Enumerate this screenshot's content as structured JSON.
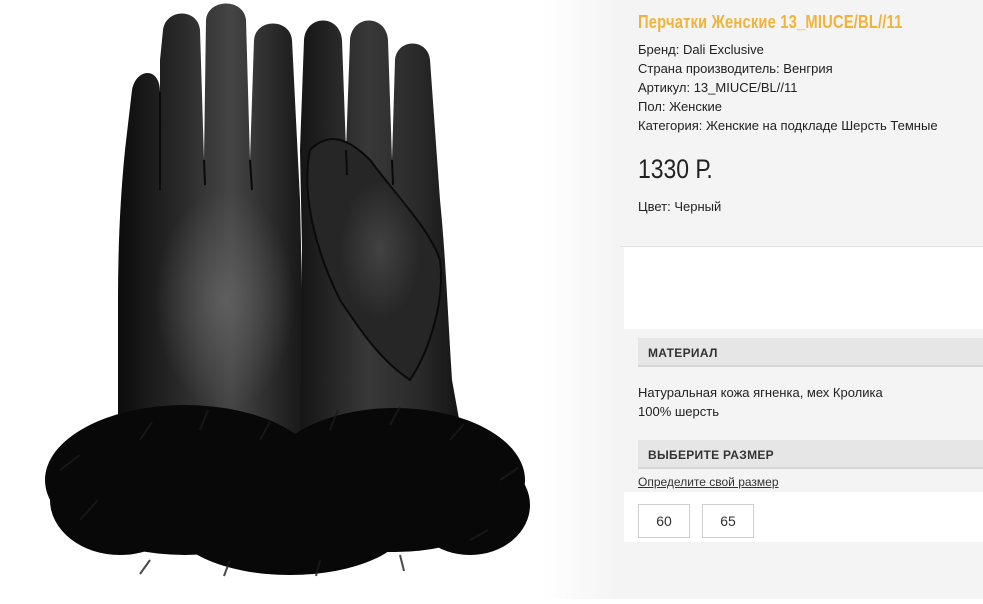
{
  "product": {
    "title": "Перчатки Женские 13_MIUCE/BL//11",
    "specs": [
      "Бренд: Dali Exclusive",
      "Страна производитель: Венгрия",
      "Артикул: 13_MIUCE/BL//11",
      "Пол: Женские",
      "Категория: Женские на подкладе Шерсть Темные"
    ],
    "price": "1330 Р.",
    "color": "Цвет: Черный"
  },
  "material": {
    "heading": "МАТЕРИАЛ",
    "lines": [
      "Натуральная кожа ягненка, мех Кролика",
      "100% шерсть"
    ]
  },
  "size": {
    "heading": "ВЫБЕРИТЕ РАЗМЕР",
    "link": "Определите свой размер",
    "options": [
      "60",
      "65"
    ]
  },
  "colors": {
    "title": "#f0b43a",
    "panel": "#f4f4f4"
  },
  "image": {
    "subject": "black-leather-gloves-with-fur-cuff"
  }
}
